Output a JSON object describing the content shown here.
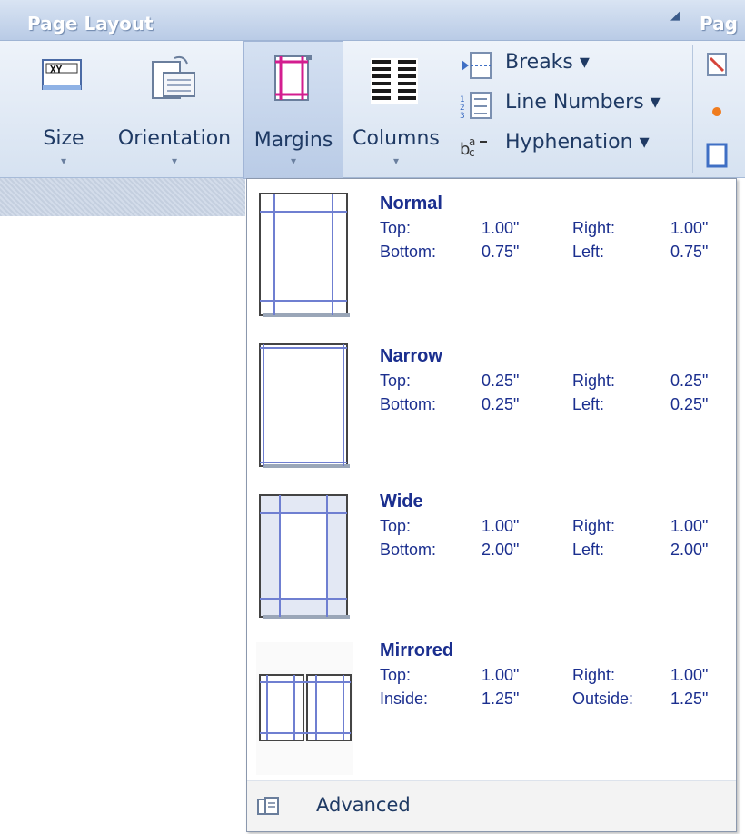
{
  "ribbon": {
    "group_title": "Page Layout",
    "next_group_title_partial": "Pag",
    "launcher_icon": "dialog-launcher-icon",
    "buttons": {
      "size": {
        "label": "Size",
        "icon": "page-size-icon"
      },
      "orientation": {
        "label": "Orientation",
        "icon": "orientation-icon"
      },
      "margins": {
        "label": "Margins",
        "icon": "margins-icon"
      },
      "columns": {
        "label": "Columns",
        "icon": "columns-icon"
      }
    },
    "small_buttons": [
      {
        "label": "Breaks ▾",
        "icon": "breaks-icon"
      },
      {
        "label": "Line Numbers ▾",
        "icon": "line-numbers-icon"
      },
      {
        "label": "Hyphenation ▾",
        "icon": "hyphenation-icon"
      }
    ],
    "dropdown_arrow": "▾"
  },
  "margins_menu": {
    "options": [
      {
        "name": "Normal",
        "labels": [
          "Top:",
          "Right:",
          "Bottom:",
          "Left:"
        ],
        "values": [
          "1.00\"",
          "1.00\"",
          "0.75\"",
          "0.75\""
        ]
      },
      {
        "name": "Narrow",
        "labels": [
          "Top:",
          "Right:",
          "Bottom:",
          "Left:"
        ],
        "values": [
          "0.25\"",
          "0.25\"",
          "0.25\"",
          "0.25\""
        ]
      },
      {
        "name": "Wide",
        "labels": [
          "Top:",
          "Right:",
          "Bottom:",
          "Left:"
        ],
        "values": [
          "1.00\"",
          "1.00\"",
          "2.00\"",
          "2.00\""
        ]
      },
      {
        "name": "Mirrored",
        "labels": [
          "Top:",
          "Right:",
          "Inside:",
          "Outside:"
        ],
        "values": [
          "1.00\"",
          "1.00\"",
          "1.25\"",
          "1.25\""
        ]
      }
    ],
    "advanced": {
      "label": "Advanced",
      "icon": "page-setup-icon"
    }
  },
  "colors": {
    "menu_text": "#1b2f8f",
    "ribbon_text": "#1f3a64",
    "margin_line": "#6f7fd1"
  }
}
